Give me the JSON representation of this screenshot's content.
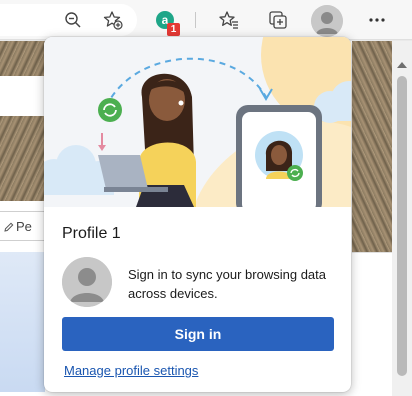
{
  "toolbar": {
    "zoom_icon": "zoom-out-icon",
    "add_favorite_icon": "add-favorite-icon",
    "extension_icon": "extension-icon",
    "extension_badge": "1",
    "favorites_icon": "favorites-icon",
    "collections_icon": "collections-icon",
    "profile_icon": "profile-avatar-icon",
    "more_label": "···"
  },
  "page": {
    "edit_chip_label": "Pe"
  },
  "profile_flyout": {
    "profile_name": "Profile 1",
    "sync_message": "Sign in to sync your browsing data across devices.",
    "sign_in_label": "Sign in",
    "manage_link": "Manage profile settings"
  },
  "colors": {
    "accent": "#2a63bf",
    "link": "#1a56b0",
    "badge": "#e53935",
    "sync_green": "#4caf50"
  }
}
